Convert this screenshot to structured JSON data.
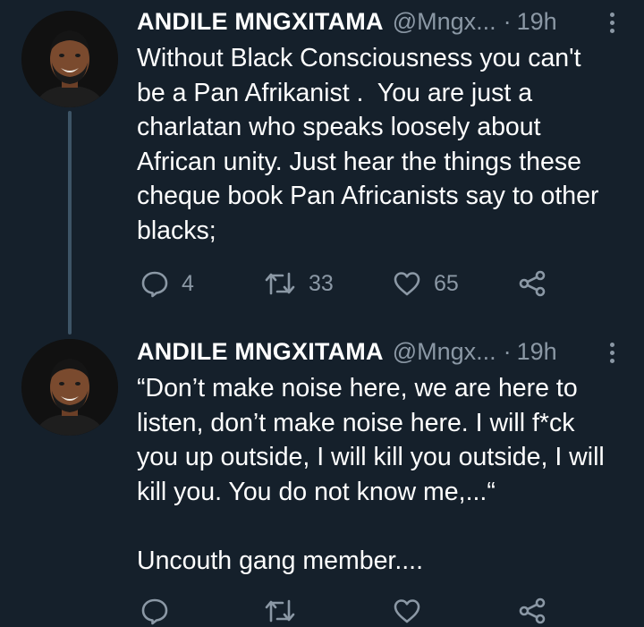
{
  "colors": {
    "background": "#15202b",
    "text": "#ffffff",
    "secondary": "#8b98a5",
    "thread_line": "#3d5466"
  },
  "tweets": [
    {
      "author_name": "ANDILE MNGXITAMA",
      "handle": "@Mngx...",
      "separator": "·",
      "time": "19h",
      "text": "Without Black Consciousness you can't\nbe a Pan Afrikanist .  You are just a\ncharlatan who speaks loosely about\nAfrican unity. Just hear the things these\ncheque book Pan Africanists say to other\nblacks;",
      "reply_count": "4",
      "retweet_count": "33",
      "like_count": "65",
      "icons": [
        "reply-icon",
        "retweet-icon",
        "like-icon",
        "share-icon",
        "more-icon"
      ]
    },
    {
      "author_name": "ANDILE MNGXITAMA",
      "handle": "@Mngx...",
      "separator": "·",
      "time": "19h",
      "text": "“Don’t make noise here, we are here to\nlisten, don’t make noise here. I will f*ck\nyou up outside, I will kill you outside, I will\nkill you. You do not know me,...“\n\nUncouth gang member....",
      "icons": [
        "reply-icon",
        "retweet-icon",
        "like-icon",
        "share-icon",
        "more-icon"
      ]
    }
  ]
}
